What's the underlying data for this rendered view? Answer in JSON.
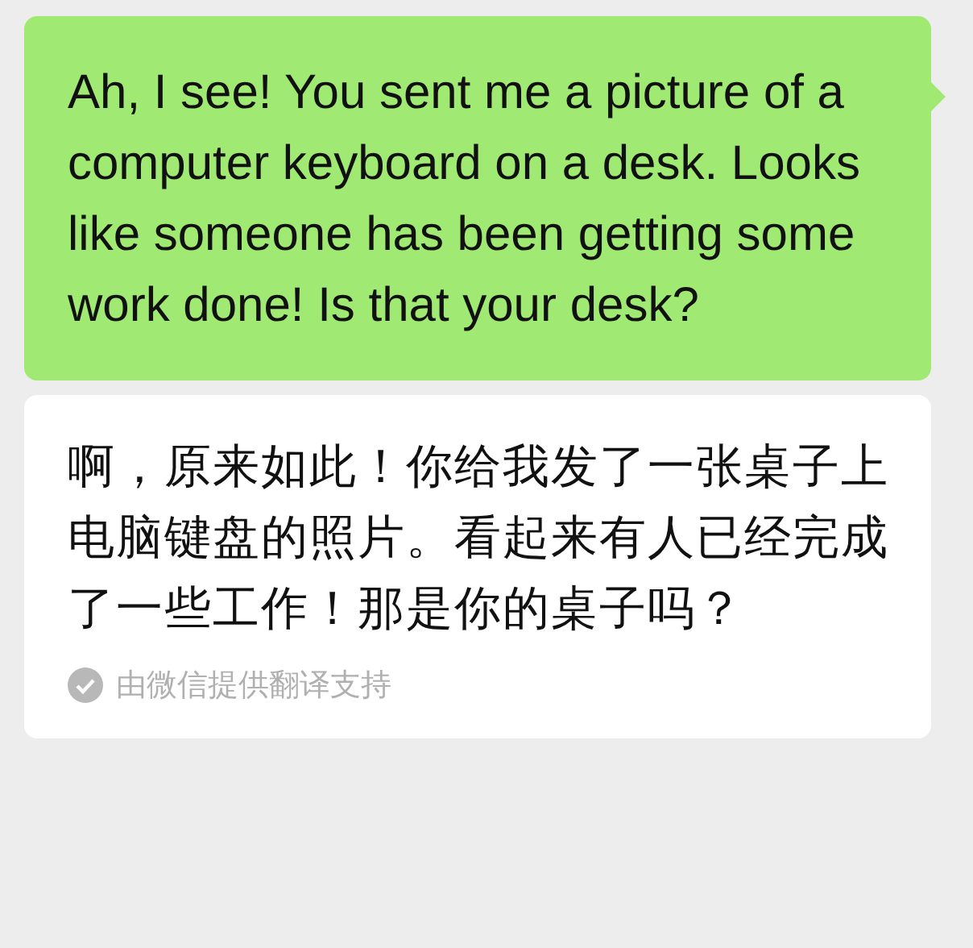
{
  "message": {
    "text": "Ah, I see! You sent me a picture of a computer keyboard on a desk. Looks like someone has been getting some work done! Is that your desk?"
  },
  "translation": {
    "text": "啊，原来如此！你给我发了一张桌子上电脑键盘的照片。看起来有人已经完成了一些工作！那是你的桌子吗？",
    "footer": "由微信提供翻译支持"
  }
}
